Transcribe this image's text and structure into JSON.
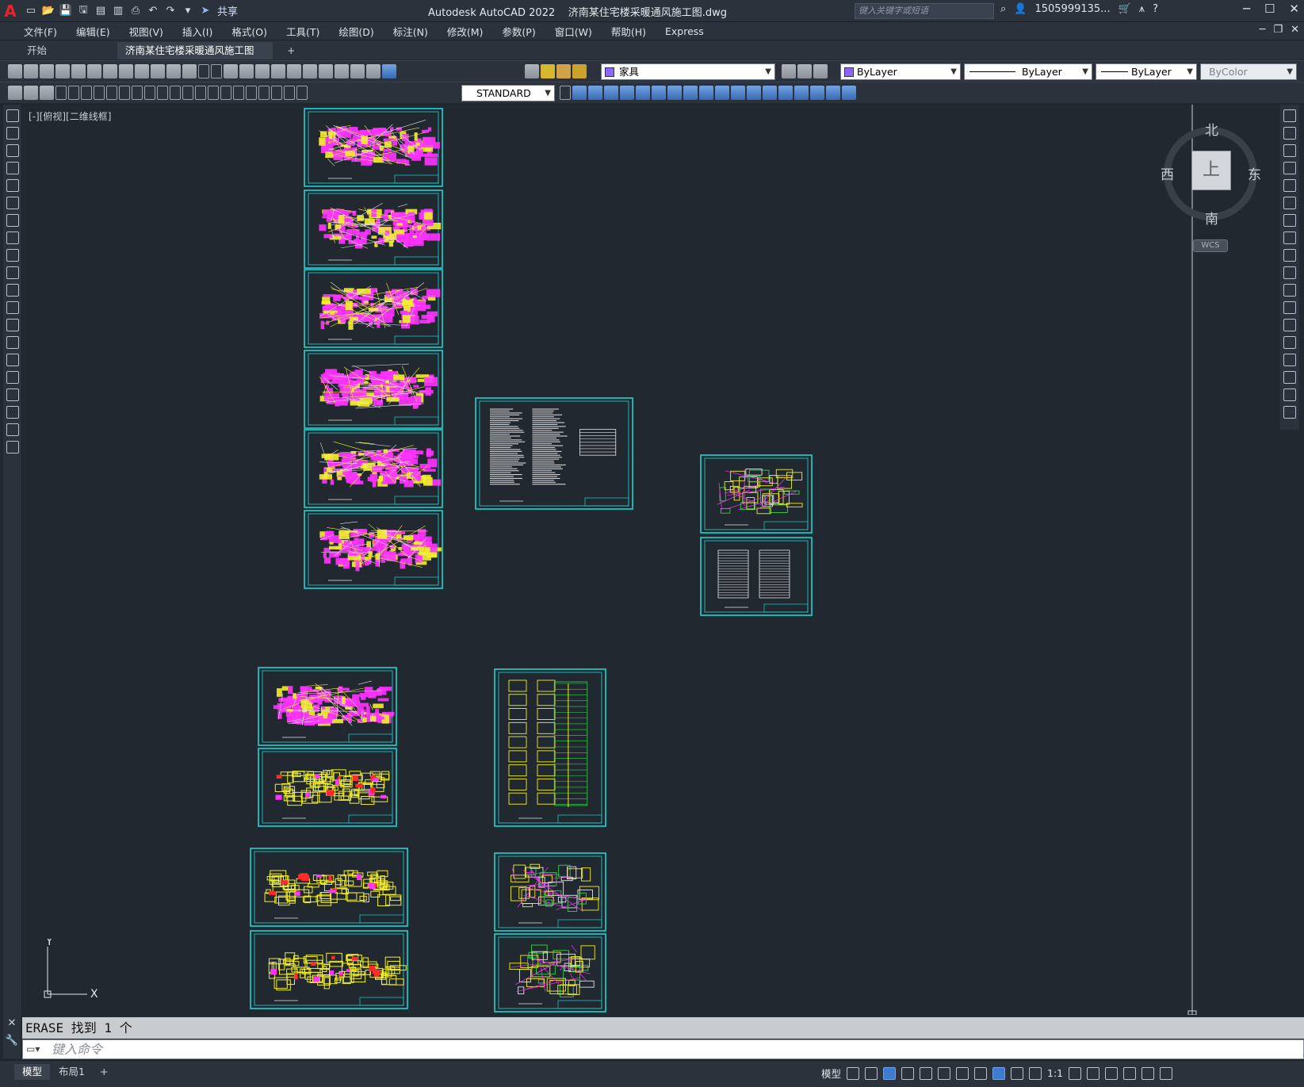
{
  "app": {
    "logo": "A",
    "title": "Autodesk AutoCAD 2022",
    "document": "济南某住宅楼采暖通风施工图.dwg",
    "share_label": "共享",
    "search_placeholder": "键入关键字或短语",
    "user": "1505999135...",
    "window_buttons": [
      "─",
      "☐",
      "✕"
    ]
  },
  "menu": {
    "items": [
      "文件(F)",
      "编辑(E)",
      "视图(V)",
      "插入(I)",
      "格式(O)",
      "工具(T)",
      "绘图(D)",
      "标注(N)",
      "修改(M)",
      "参数(P)",
      "窗口(W)",
      "帮助(H)",
      "Express"
    ],
    "mdi_buttons": [
      "─",
      "❐",
      "✕"
    ]
  },
  "tabs": {
    "start": "开始",
    "active": "济南某住宅楼采暖通风施工图*",
    "add": "+"
  },
  "properties": {
    "layer": "家具",
    "color": "ByLayer",
    "linetype": "ByLayer",
    "lineweight": "ByLayer",
    "plotstyle": "ByColor",
    "textstyle": "STANDARD"
  },
  "viewport": {
    "label": "[-][俯视][二维线框]"
  },
  "viewcube": {
    "top": "上",
    "north": "北",
    "south": "南",
    "east": "东",
    "west": "西",
    "wcs": "WCS"
  },
  "ucs": {
    "x": "X",
    "y": "Y"
  },
  "command": {
    "history": "ERASE 找到 1 个",
    "placeholder": "键入命令"
  },
  "status": {
    "model_tab": "模型",
    "layout1_tab": "布局1",
    "add_layout": "+",
    "model_button": "模型",
    "scale": "1:1"
  },
  "colors": {
    "frame": "#19d6d6",
    "magenta": "#ff33ff",
    "yellow": "#f2ef2a",
    "green": "#2fd34a",
    "red": "#ff2a2a",
    "white": "#e6e6e6",
    "canvas": "#212830"
  }
}
